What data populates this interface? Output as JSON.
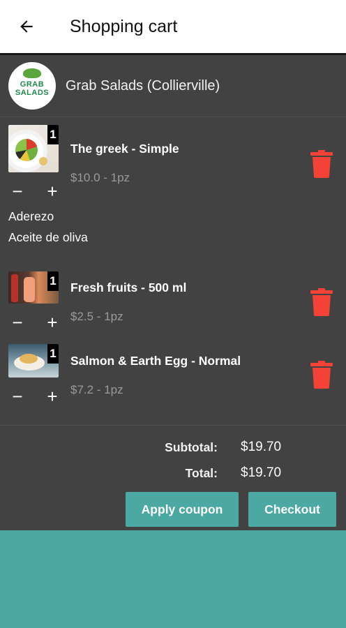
{
  "header": {
    "title": "Shopping cart",
    "back_icon": "arrow-left-icon"
  },
  "store": {
    "name": "Grab Salads (Collierville)",
    "logo_line1": "GRAB",
    "logo_line2": "SALADS"
  },
  "items": [
    {
      "name": "The greek - Simple",
      "price": "$10.0 - 1pz",
      "qty": "1",
      "extras": [
        {
          "title": "Aderezo",
          "value": "Aceite de oliva"
        }
      ]
    },
    {
      "name": "Fresh fruits - 500 ml",
      "price": "$2.5 - 1pz",
      "qty": "1"
    },
    {
      "name": "Salmon & Earth Egg - Normal",
      "price": "$7.2 - 1pz",
      "qty": "1"
    }
  ],
  "stepper": {
    "minus": "−",
    "plus": "+"
  },
  "totals": {
    "subtotal_label": "Subtotal:",
    "subtotal_value": "$19.70",
    "total_label": "Total:",
    "total_value": "$19.70"
  },
  "buttons": {
    "apply_coupon": "Apply coupon",
    "checkout": "Checkout"
  },
  "colors": {
    "accent": "#4ba8a3",
    "card": "#424242",
    "delete": "#f44336"
  }
}
